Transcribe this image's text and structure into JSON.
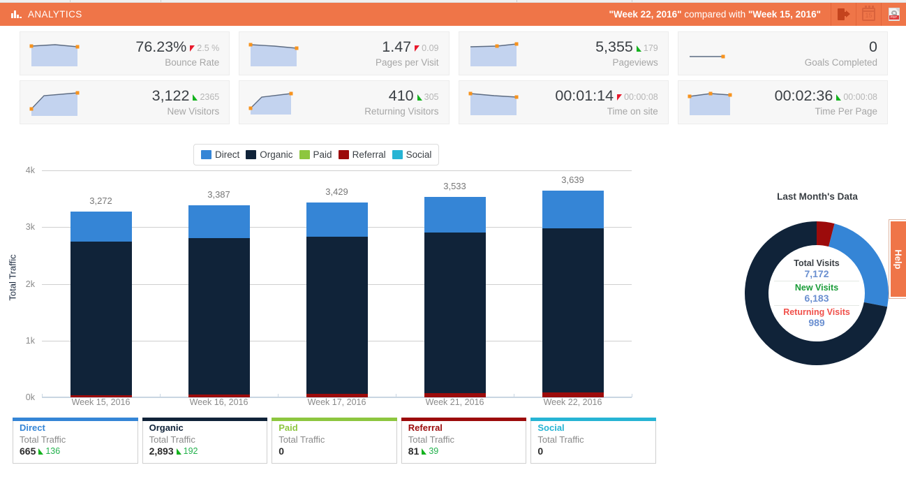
{
  "header": {
    "app_title": "ANALYTICS",
    "logo_icon": "bar-chart-icon",
    "compare_primary": "\"Week 22, 2016\"",
    "compare_middle": " compared with ",
    "compare_secondary": "\"Week 15, 2016\"",
    "icons": [
      {
        "name": "export-icon",
        "label": "Export"
      },
      {
        "name": "calendar-icon",
        "label": "Date Range",
        "day": "15"
      },
      {
        "name": "pdf-icon",
        "label": "PDF",
        "text": "PDF"
      }
    ]
  },
  "kpis": [
    {
      "value": "76.23%",
      "delta": "2.5 %",
      "direction": "down",
      "label": "Bounce Rate",
      "spark": "filled-flat"
    },
    {
      "value": "1.47",
      "delta": "0.09",
      "direction": "down",
      "label": "Pages per Visit",
      "spark": "filled-flat"
    },
    {
      "value": "5,355",
      "delta": "179",
      "direction": "up",
      "label": "Pageviews",
      "spark": "filled-rise"
    },
    {
      "value": "0",
      "delta": "",
      "direction": "none",
      "label": "Goals Completed",
      "spark": "line-flat"
    },
    {
      "value": "3,122",
      "delta": "2365",
      "direction": "up",
      "label": "New Visitors",
      "spark": "filled-steep"
    },
    {
      "value": "410",
      "delta": "305",
      "direction": "up",
      "label": "Returning Visitors",
      "spark": "filled-steep"
    },
    {
      "value": "00:01:14",
      "delta": "00:00:08",
      "direction": "down",
      "label": "Time on site",
      "spark": "filled-flat"
    },
    {
      "value": "00:02:36",
      "delta": "00:00:08",
      "direction": "up",
      "label": "Time Per Page",
      "spark": "filled-flat"
    }
  ],
  "colors": {
    "direct": "#3585d6",
    "organic": "#102339",
    "paid": "#8dc63f",
    "referral": "#9c0b0b",
    "social": "#27b4d4",
    "accent": "#ef7548",
    "up": "#14b21e",
    "down": "#e8192c"
  },
  "legend": [
    {
      "label": "Direct",
      "color": "#3585d6"
    },
    {
      "label": "Organic",
      "color": "#102339"
    },
    {
      "label": "Paid",
      "color": "#8dc63f"
    },
    {
      "label": "Referral",
      "color": "#9c0b0b"
    },
    {
      "label": "Social",
      "color": "#27b4d4"
    }
  ],
  "chart_data": {
    "type": "bar",
    "title": "",
    "xlabel": "",
    "ylabel": "Total Traffic",
    "stacked": true,
    "grid": true,
    "legend_position": "top-center",
    "ylim": [
      0,
      4000
    ],
    "ytick_labels": [
      "0k",
      "1k",
      "2k",
      "3k",
      "4k"
    ],
    "ytick_values": [
      0,
      1000,
      2000,
      3000,
      4000
    ],
    "categories": [
      "Week 15, 2016",
      "Week 16, 2016",
      "Week 17, 2016",
      "Week 21, 2016",
      "Week 22, 2016"
    ],
    "totals": [
      3272,
      3387,
      3429,
      3533,
      3639
    ],
    "series": [
      {
        "name": "Referral",
        "color": "#9c0b0b",
        "values": [
          42,
          45,
          60,
          72,
          81
        ]
      },
      {
        "name": "Organic",
        "color": "#102339",
        "values": [
          2699,
          2757,
          2769,
          2836,
          2893
        ]
      },
      {
        "name": "Direct",
        "color": "#3585d6",
        "values": [
          531,
          585,
          600,
          625,
          665
        ]
      },
      {
        "name": "Paid",
        "color": "#8dc63f",
        "values": [
          0,
          0,
          0,
          0,
          0
        ]
      },
      {
        "name": "Social",
        "color": "#27b4d4",
        "values": [
          0,
          0,
          0,
          0,
          0
        ]
      }
    ]
  },
  "donut": {
    "title": "Last Month's Data",
    "type": "donut",
    "segments": [
      {
        "name": "Referral",
        "color": "#9c0b0b",
        "percent": 4
      },
      {
        "name": "Direct",
        "color": "#3585d6",
        "percent": 24
      },
      {
        "name": "Organic",
        "color": "#102339",
        "percent": 72
      }
    ],
    "center_rows": [
      {
        "label": "Total Visits",
        "label_color": "#3a3f44",
        "value": "7,172"
      },
      {
        "label": "New Visits",
        "label_color": "#1a9c38",
        "value": "6,183"
      },
      {
        "label": "Returning Visits",
        "label_color": "#f0504a",
        "value": "989"
      }
    ]
  },
  "help_tab": {
    "label": "Help"
  },
  "source_boxes": [
    {
      "name": "Direct",
      "color": "#3585d6",
      "sub": "Total Traffic",
      "value": "665",
      "delta": "136",
      "direction": "up"
    },
    {
      "name": "Organic",
      "color": "#102339",
      "sub": "Total Traffic",
      "value": "2,893",
      "delta": "192",
      "direction": "up"
    },
    {
      "name": "Paid",
      "color": "#8dc63f",
      "sub": "Total Traffic",
      "value": "0",
      "delta": "",
      "direction": "none"
    },
    {
      "name": "Referral",
      "color": "#9c0b0b",
      "sub": "Total Traffic",
      "value": "81",
      "delta": "39",
      "direction": "up"
    },
    {
      "name": "Social",
      "color": "#27b4d4",
      "sub": "Total Traffic",
      "value": "0",
      "delta": "",
      "direction": "none"
    }
  ]
}
